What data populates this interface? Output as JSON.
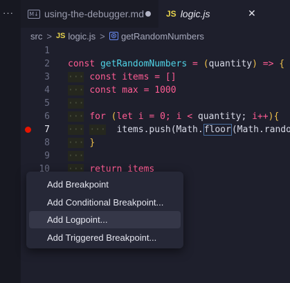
{
  "activity": {
    "dots": "···"
  },
  "tabs": [
    {
      "label": "using-the-debugger.md",
      "icon": "markdown-icon",
      "dirty": true,
      "active": false
    },
    {
      "label": "logic.js",
      "badge": "JS",
      "active": true,
      "close": "✕"
    }
  ],
  "breadcrumb": {
    "folder": "src",
    "sep1": ">",
    "badge": "JS",
    "file": "logic.js",
    "sep2": ">",
    "symbol": "getRandomNumbers"
  },
  "gutter": [
    "1",
    "2",
    "3",
    "4",
    "5",
    "6",
    "7",
    "8",
    "9",
    "10"
  ],
  "code": {
    "l2": {
      "kw": "const",
      "fn": "getRandomNumbers",
      "eq": "=",
      "po": "(",
      "arg": "quantity",
      "pc": ")",
      "arrow": "=>",
      "brace": "{"
    },
    "l3": {
      "kw": "const",
      "var": "items",
      "eq": "=",
      "val": "[]"
    },
    "l4": {
      "kw": "const",
      "var": "max",
      "eq": "=",
      "val": "1000"
    },
    "l6": {
      "kw": "for",
      "po": "(",
      "let": "let",
      "i": "i",
      "eq": "=",
      "zero": "0;",
      "i2": "i",
      "lt": "<",
      "q": "quantity;",
      "inc": "i++",
      "pc": ")",
      "brace": "{"
    },
    "l7": {
      "a": "items.",
      "b": "push(Math.",
      "c": "floor",
      "d": "(Math.random("
    },
    "l8": {
      "brace": "}"
    },
    "l10": {
      "kw": "return",
      "var": "items"
    }
  },
  "context_menu": [
    {
      "label": "Add Breakpoint"
    },
    {
      "label": "Add Conditional Breakpoint..."
    },
    {
      "label": "Add Logpoint..."
    },
    {
      "label": "Add Triggered Breakpoint..."
    }
  ],
  "colors": {
    "breakpoint": "#e51400",
    "js_badge": "#e8d44d"
  }
}
